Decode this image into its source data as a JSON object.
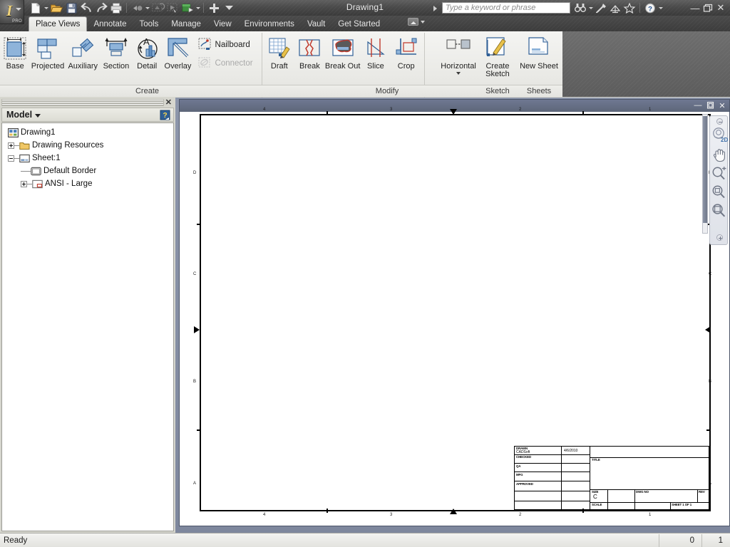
{
  "window": {
    "title": "Drawing1",
    "app_badge": "PRO",
    "minimize": "—",
    "restore": "❐",
    "close": "✕"
  },
  "quick_access": {
    "buttons": [
      {
        "name": "new-file-icon",
        "label": "New"
      },
      {
        "name": "new-file-dropdown-icon",
        "label": "New options"
      },
      {
        "name": "open-file-icon",
        "label": "Open"
      },
      {
        "name": "save-icon",
        "label": "Save"
      },
      {
        "name": "undo-icon",
        "label": "Undo"
      },
      {
        "name": "redo-icon",
        "label": "Redo"
      },
      {
        "name": "print-icon",
        "label": "Print"
      },
      {
        "name": "return-icon",
        "label": "Return"
      },
      {
        "name": "return-dropdown-icon",
        "label": "Return options"
      },
      {
        "name": "update-icon",
        "label": "Update"
      },
      {
        "name": "select-icon",
        "label": "Select"
      },
      {
        "name": "material-icon",
        "label": "Material"
      },
      {
        "name": "material-dropdown-icon",
        "label": "Material options"
      },
      {
        "name": "customize-icon",
        "label": "Customize Quick Access Toolbar"
      },
      {
        "name": "qat-overflow-icon",
        "label": "More"
      }
    ]
  },
  "search": {
    "placeholder": "Type a keyword or phrase",
    "icons": [
      {
        "name": "search-binoculars-icon",
        "label": "Search"
      },
      {
        "name": "search-dropdown-icon",
        "label": "Search options"
      },
      {
        "name": "inventor-help-wrench-icon",
        "label": "Help Tools"
      },
      {
        "name": "subscription-center-icon",
        "label": "Subscription Center"
      },
      {
        "name": "favorites-star-icon",
        "label": "Favorites"
      },
      {
        "name": "help-circle-icon",
        "label": "Help"
      },
      {
        "name": "help-dropdown-icon",
        "label": "Help options"
      }
    ]
  },
  "ribbon": {
    "tabs": [
      {
        "label": "Place Views",
        "active": true
      },
      {
        "label": "Annotate",
        "active": false
      },
      {
        "label": "Tools",
        "active": false
      },
      {
        "label": "Manage",
        "active": false
      },
      {
        "label": "View",
        "active": false
      },
      {
        "label": "Environments",
        "active": false
      },
      {
        "label": "Vault",
        "active": false
      },
      {
        "label": "Get Started",
        "active": false
      }
    ],
    "panels": [
      {
        "label": "Create",
        "big_buttons": [
          {
            "label": "Base",
            "icon": "base-view-icon"
          },
          {
            "label": "Projected",
            "icon": "projected-view-icon"
          },
          {
            "label": "Auxiliary",
            "icon": "auxiliary-view-icon"
          },
          {
            "label": "Section",
            "icon": "section-view-icon"
          },
          {
            "label": "Detail",
            "icon": "detail-view-icon"
          },
          {
            "label": "Overlay",
            "icon": "overlay-view-icon"
          }
        ],
        "small_buttons": [
          {
            "label": "Nailboard",
            "icon": "nailboard-icon",
            "disabled": false
          },
          {
            "label": "Connector",
            "icon": "connector-icon",
            "disabled": true
          }
        ],
        "trailing_big": [
          {
            "label": "Draft",
            "icon": "draft-view-icon"
          }
        ]
      },
      {
        "label": "Modify",
        "big_buttons": [
          {
            "label": "Break",
            "icon": "break-icon"
          },
          {
            "label": "Break Out",
            "icon": "break-out-icon"
          },
          {
            "label": "Slice",
            "icon": "slice-icon"
          },
          {
            "label": "Crop",
            "icon": "crop-icon"
          },
          {
            "label": "Horizontal",
            "icon": "horizontal-retrieve-icon",
            "has_dropdown": true
          }
        ]
      },
      {
        "label": "Sketch",
        "big_buttons": [
          {
            "label": "Create\nSketch",
            "icon": "create-sketch-icon"
          }
        ]
      },
      {
        "label": "Sheets",
        "big_buttons": [
          {
            "label": "New Sheet",
            "icon": "new-sheet-icon"
          }
        ]
      }
    ]
  },
  "browser": {
    "title": "Model",
    "close_label": "✕",
    "help_icon": "help-question-icon",
    "tree": [
      {
        "label": "Drawing1",
        "depth": 0,
        "icon": "drawing-document-icon",
        "expander": "none"
      },
      {
        "label": "Drawing Resources",
        "depth": 1,
        "icon": "folder-icon",
        "expander": "plus"
      },
      {
        "label": "Sheet:1",
        "depth": 1,
        "icon": "sheet-icon",
        "expander": "minus"
      },
      {
        "label": "Default Border",
        "depth": 2,
        "icon": "border-icon",
        "expander": "none"
      },
      {
        "label": "ANSI - Large",
        "depth": 2,
        "icon": "title-block-icon",
        "expander": "plus"
      }
    ]
  },
  "document_window": {
    "minimize": "—",
    "restore": "❐",
    "close": "✕"
  },
  "sheet": {
    "zone_columns": [
      "4",
      "3",
      "2",
      "1"
    ],
    "zone_rows": [
      "D",
      "C",
      "B",
      "A"
    ],
    "title_block": {
      "rows": [
        {
          "label": "DRAWN",
          "value": "CADSoft",
          "value2": "4/6/2010"
        },
        {
          "label": "CHECKED",
          "value": "",
          "value2": ""
        },
        {
          "label": "QA",
          "value": "",
          "value2": ""
        },
        {
          "label": "MFG",
          "value": "",
          "value2": ""
        },
        {
          "label": "APPROVED",
          "value": "",
          "value2": ""
        },
        {
          "label": "",
          "value": "",
          "value2": ""
        },
        {
          "label": "",
          "value": "",
          "value2": ""
        }
      ],
      "title_label": "TITLE",
      "title_value": "",
      "size_label": "SIZE",
      "size_value": "C",
      "dwg_no_label": "DWG NO",
      "dwg_no_value": "",
      "rev_label": "REV",
      "rev_value": "",
      "scale_label": "SCALE",
      "scale_value": "",
      "sheet_label": "SHEET 1  OF 1"
    }
  },
  "navbar": {
    "items": [
      {
        "name": "view-cube-2d-icon",
        "label": "2D"
      },
      {
        "name": "pan-hand-icon",
        "label": "Pan"
      },
      {
        "name": "zoom-in-icon",
        "label": "Zoom"
      },
      {
        "name": "zoom-window-icon",
        "label": "Zoom Window"
      },
      {
        "name": "zoom-all-icon",
        "label": "Zoom All"
      }
    ],
    "close_label": "✕",
    "expand_label": "—"
  },
  "status_bar": {
    "message": "Ready",
    "cells": [
      "0",
      "1"
    ]
  },
  "colors": {
    "titlebar_dark": "#4a4a4a",
    "ribbon_bg": "#ecece8",
    "mdi_blue": "#858ea3",
    "icon_blue": "#8ab0d8",
    "icon_blue_dark": "#2a5a96",
    "accent_red": "#c0392b",
    "folder_yellow": "#e8bc5a"
  }
}
